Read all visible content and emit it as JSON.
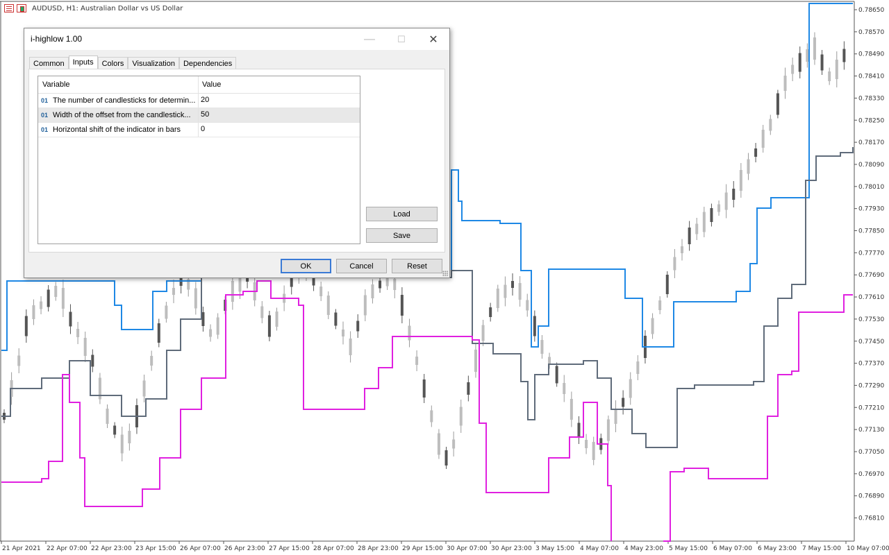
{
  "chart": {
    "title": "AUDUSD, H1:  Australian Dollar vs US Dollar",
    "price_labels": [
      "0.78650",
      "0.78570",
      "0.78490",
      "0.78410",
      "0.78330",
      "0.78250",
      "0.78170",
      "0.78090",
      "0.78010",
      "0.77930",
      "0.77850",
      "0.77770",
      "0.77690",
      "0.77610",
      "0.77530",
      "0.77450",
      "0.77370",
      "0.77290",
      "0.77210",
      "0.77130",
      "0.77050",
      "0.76970",
      "0.76890",
      "0.76810"
    ],
    "time_labels": [
      "21 Apr 2021",
      "22 Apr 07:00",
      "22 Apr 23:00",
      "23 Apr 15:00",
      "26 Apr 07:00",
      "26 Apr 23:00",
      "27 Apr 15:00",
      "28 Apr 07:00",
      "28 Apr 23:00",
      "29 Apr 15:00",
      "30 Apr 07:00",
      "30 Apr 23:00",
      "3 May 15:00",
      "4 May 07:00",
      "4 May 23:00",
      "5 May 15:00",
      "6 May 07:00",
      "6 May 23:00",
      "7 May 15:00",
      "10 May 07:00"
    ],
    "colors": {
      "upper": "#1e88e5",
      "middle": "#5f6b7a",
      "lower": "#e020e0",
      "candles": "#9a9a9a",
      "candles_dark": "#555555"
    }
  },
  "dialog": {
    "title": "i-highlow 1.00",
    "tabs": [
      "Common",
      "Inputs",
      "Colors",
      "Visualization",
      "Dependencies"
    ],
    "active_tab": "Inputs",
    "grid": {
      "headers": {
        "variable": "Variable",
        "value": "Value"
      },
      "rows": [
        {
          "icon": "01",
          "variable": "The number of candlesticks for determin...",
          "value": "20"
        },
        {
          "icon": "01",
          "variable": "Width of the offset from the candlestick...",
          "value": "50"
        },
        {
          "icon": "01",
          "variable": "Horizontal shift of the indicator in bars",
          "value": "0"
        }
      ]
    },
    "buttons": {
      "load": "Load",
      "save": "Save",
      "ok": "OK",
      "cancel": "Cancel",
      "reset": "Reset"
    },
    "window_controls": {
      "minimize": "—",
      "maximize": "☐",
      "close": "✕"
    }
  }
}
